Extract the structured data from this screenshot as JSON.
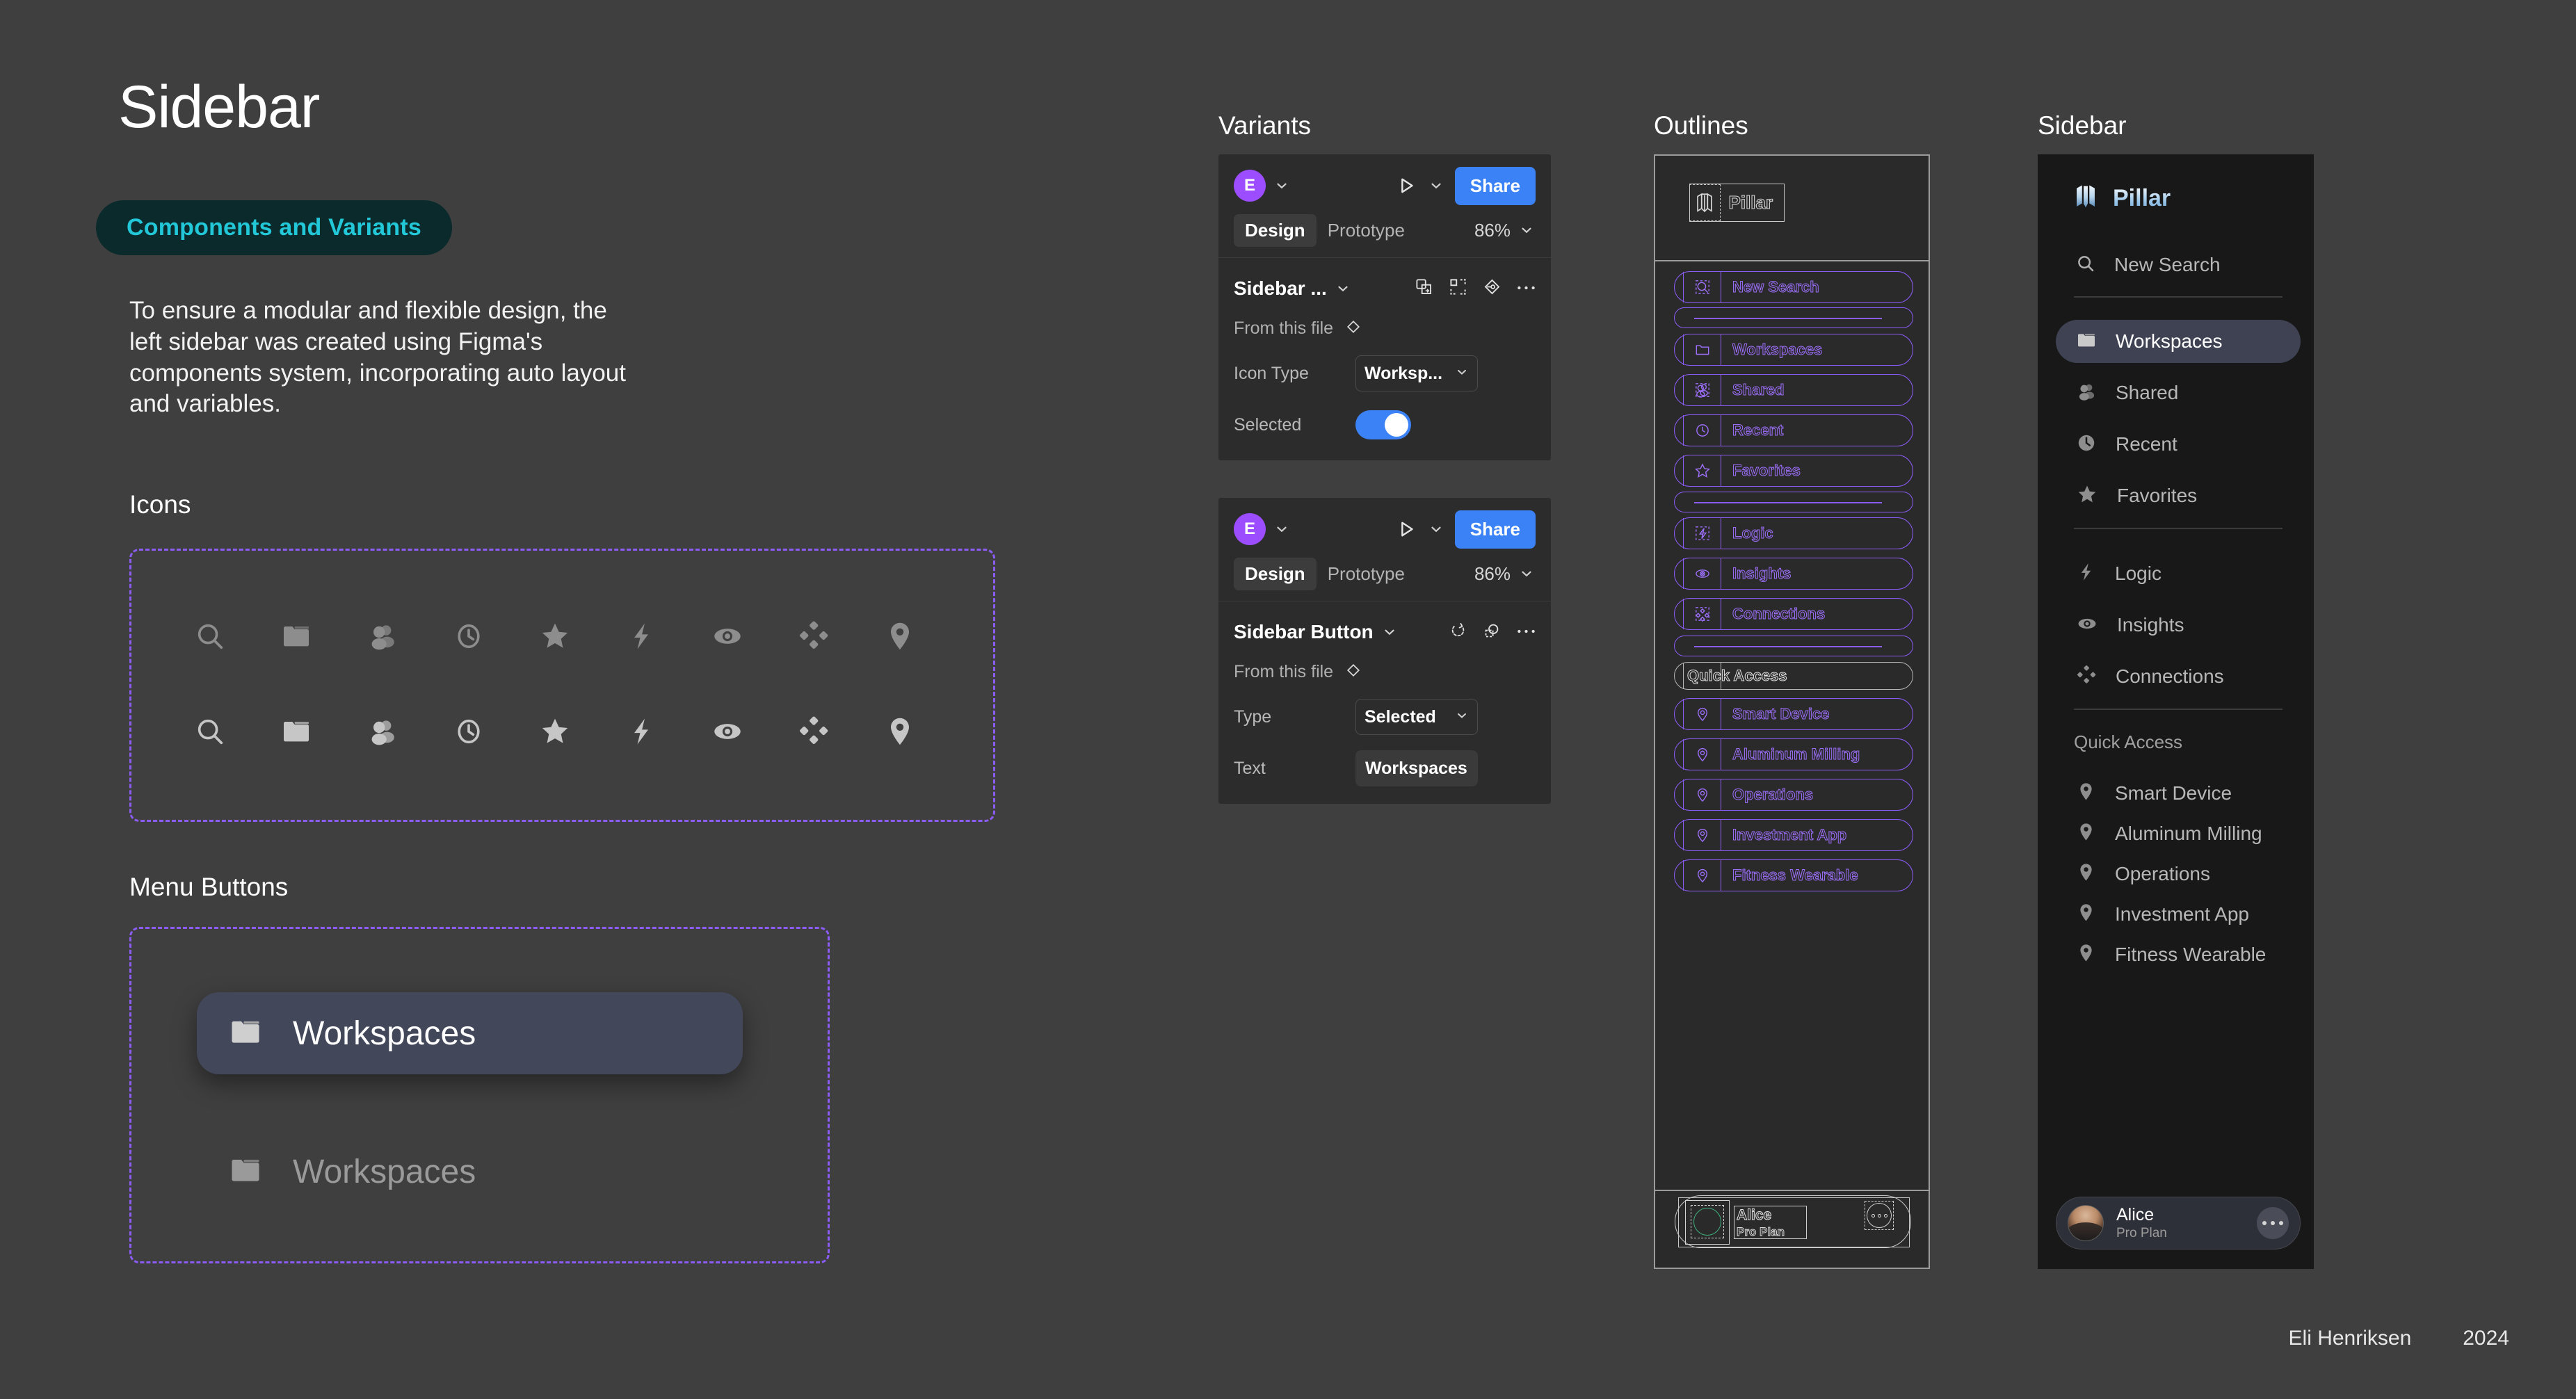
{
  "page": {
    "title": "Sidebar",
    "tag": "Components and Variants",
    "intro": "To ensure a modular and flexible design, the left sidebar was created using Figma's components system, incorporating auto layout and variables.",
    "icons_label": "Icons",
    "menu_label": "Menu Buttons",
    "bg_color": "#3f3f3f",
    "accent_cyan": "#22c8d8",
    "accent_purple": "#8b5cf6"
  },
  "columns": {
    "variants_heading": "Variants",
    "outlines_heading": "Outlines",
    "sidebar_heading": "Sidebar"
  },
  "icons_row": [
    {
      "name": "search-icon"
    },
    {
      "name": "folder-icon"
    },
    {
      "name": "people-icon"
    },
    {
      "name": "clock-icon"
    },
    {
      "name": "star-icon"
    },
    {
      "name": "bolt-icon"
    },
    {
      "name": "eye-icon"
    },
    {
      "name": "connections-icon"
    },
    {
      "name": "pin-icon"
    }
  ],
  "menu_buttons": [
    {
      "state": "Selected",
      "label": "Workspaces",
      "icon": "folder-icon"
    },
    {
      "state": "Default",
      "label": "Workspaces",
      "icon": "folder-icon"
    }
  ],
  "variant_cards": [
    {
      "avatar_initial": "E",
      "share_label": "Share",
      "tabs": [
        "Design",
        "Prototype"
      ],
      "active_tab": "Design",
      "zoom": "86%",
      "component_name": "Sidebar ...",
      "source_label": "From this file",
      "toolbar_icons": [
        "swap-instance-icon",
        "detach-icon",
        "component-icon",
        "more-icon"
      ],
      "properties": [
        {
          "label": "Icon Type",
          "type": "select",
          "value": "Worksp..."
        },
        {
          "label": "Selected",
          "type": "toggle",
          "value": "on"
        }
      ]
    },
    {
      "avatar_initial": "E",
      "share_label": "Share",
      "tabs": [
        "Design",
        "Prototype"
      ],
      "active_tab": "Design",
      "zoom": "86%",
      "component_name": "Sidebar Button",
      "source_label": "From this file",
      "toolbar_icons": [
        "reset-icon",
        "swap-icon",
        "more-icon"
      ],
      "properties": [
        {
          "label": "Type",
          "type": "select",
          "value": "Selected"
        },
        {
          "label": "Text",
          "type": "text",
          "value": "Workspaces"
        }
      ]
    }
  ],
  "sidebar": {
    "brand": "Pillar",
    "nav": [
      {
        "label": "New Search",
        "icon": "search-icon",
        "selected": false
      },
      {
        "label": "Workspaces",
        "icon": "folder-icon",
        "selected": true
      },
      {
        "label": "Shared",
        "icon": "people-icon",
        "selected": false
      },
      {
        "label": "Recent",
        "icon": "clock-icon",
        "selected": false
      },
      {
        "label": "Favorites",
        "icon": "star-icon",
        "selected": false
      },
      {
        "label": "Logic",
        "icon": "bolt-icon",
        "selected": false
      },
      {
        "label": "Insights",
        "icon": "eye-icon",
        "selected": false
      },
      {
        "label": "Connections",
        "icon": "connections-icon",
        "selected": false
      }
    ],
    "group_label": "Quick Access",
    "quick_access": [
      {
        "label": "Smart Device",
        "icon": "pin-icon"
      },
      {
        "label": "Aluminum Milling",
        "icon": "pin-icon"
      },
      {
        "label": "Operations",
        "icon": "pin-icon"
      },
      {
        "label": "Investment App",
        "icon": "pin-icon"
      },
      {
        "label": "Fitness Wearable",
        "icon": "pin-icon"
      }
    ],
    "user": {
      "name": "Alice",
      "plan": "Pro Plan",
      "more_icon": "more-icon"
    }
  },
  "outlines": {
    "brand": "Pillar",
    "items": [
      {
        "label": "New Search",
        "type": "item"
      },
      {
        "label": "",
        "type": "divider"
      },
      {
        "label": "Workspaces",
        "type": "item"
      },
      {
        "label": "Shared",
        "type": "item"
      },
      {
        "label": "Recent",
        "type": "item"
      },
      {
        "label": "Favorites",
        "type": "item"
      },
      {
        "label": "",
        "type": "divider"
      },
      {
        "label": "Logic",
        "type": "item"
      },
      {
        "label": "Insights",
        "type": "item"
      },
      {
        "label": "Connections",
        "type": "item"
      },
      {
        "label": "",
        "type": "divider"
      },
      {
        "label": "Quick Access",
        "type": "group"
      },
      {
        "label": "Smart Device",
        "type": "item"
      },
      {
        "label": "Aluminum Milling",
        "type": "item"
      },
      {
        "label": "Operations",
        "type": "item"
      },
      {
        "label": "Investment App",
        "type": "item"
      },
      {
        "label": "Fitness Wearable",
        "type": "item"
      }
    ],
    "user": {
      "name": "Alice",
      "plan": "Pro Plan"
    }
  },
  "footer": {
    "author": "Eli Henriksen",
    "year": "2024"
  }
}
